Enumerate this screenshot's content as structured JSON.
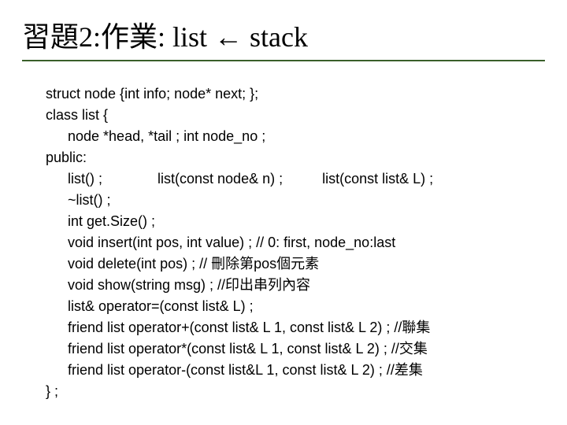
{
  "title": "習題2:作業: list ← stack",
  "code": {
    "l01": "struct node {int info; node* next; };",
    "l02": "class list {",
    "l03": "node *head, *tail ; int node_no ;",
    "l04": "public:",
    "l05a": "list() ;",
    "l05b": "list(const node& n) ;",
    "l05c": "list(const list& L) ;",
    "l06": "~list() ;",
    "l07": "int get.Size() ;",
    "l08": "void insert(int pos, int value) ; // 0: first, node_no:last",
    "l09": "void delete(int pos) ; // 刪除第pos個元素",
    "l10": "void show(string msg) ; //印出串列內容",
    "l11": "list& operator=(const list& L) ;",
    "l12": "friend list operator+(const list& L 1, const list& L 2) ; //聯集",
    "l13": "friend list operator*(const list& L 1, const list& L 2) ; //交集",
    "l14": "friend list operator-(const list&L 1, const list& L 2) ; //差集",
    "l15": "} ;"
  }
}
